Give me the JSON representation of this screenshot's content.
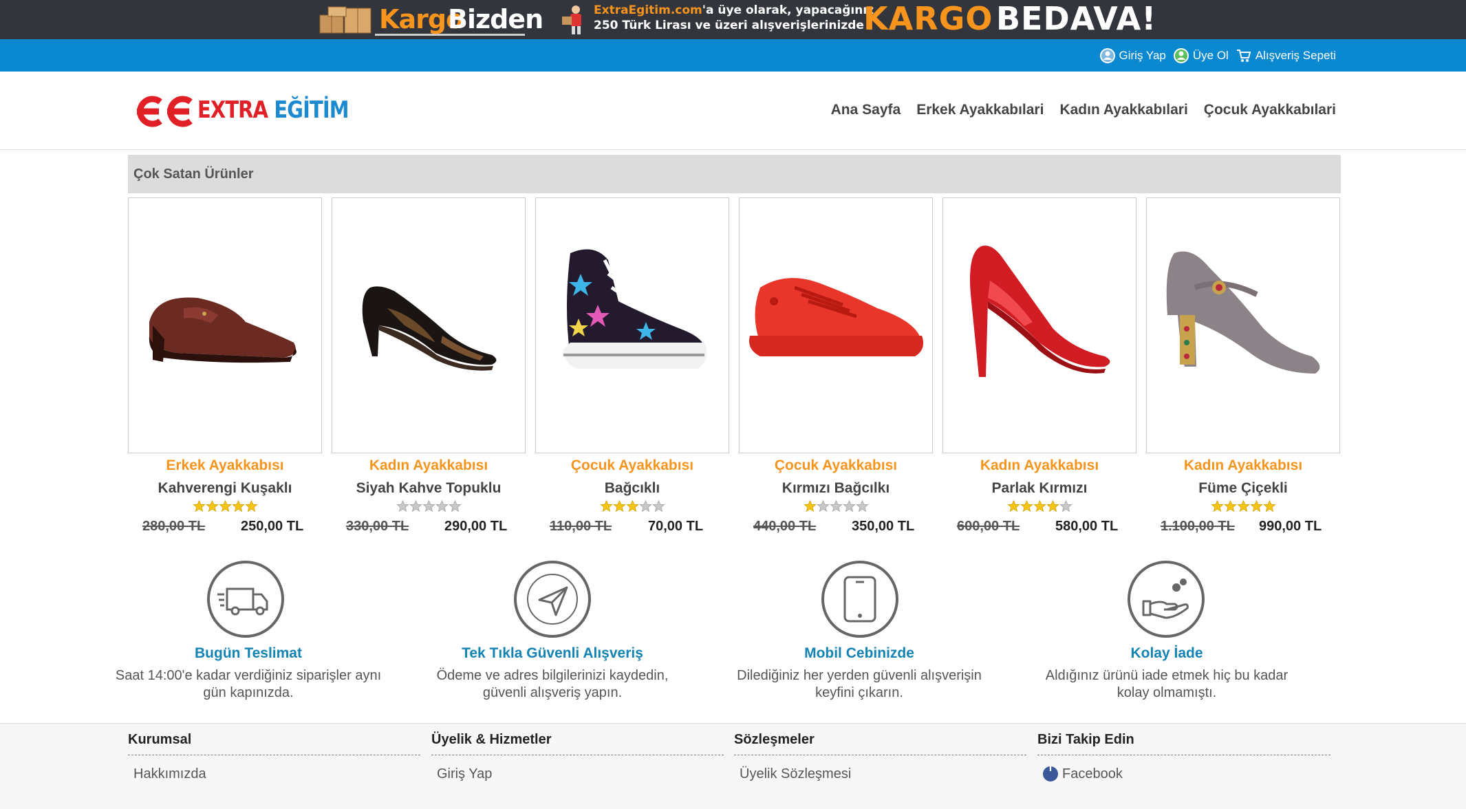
{
  "promo_banner": {
    "logo_part1": "Kargo",
    "logo_part2": "Bizden",
    "line1_brand": "ExtraEgitim.com",
    "line1_rest": "'a üye olarak, yapacağınız",
    "line2": "250 Türk Lirası ve üzeri alışverişlerinizde",
    "big1": "KARGO",
    "big2": "BEDAVA!"
  },
  "account_bar": {
    "login": "Giriş Yap",
    "register": "Üye Ol",
    "cart": "Alışveriş Sepeti"
  },
  "header": {
    "logo_word1": "EXTRA",
    "logo_word2": "EĞİTİM",
    "nav": [
      "Ana Sayfa",
      "Erkek Ayakkabılari",
      "Kadın Ayakkabılari",
      "Çocuk Ayakkabılari"
    ]
  },
  "best_sellers": {
    "title": "Çok Satan Ürünler",
    "products": [
      {
        "category": "Erkek Ayakkabısı",
        "name": "Kahverengi Kuşaklı",
        "rating": 5,
        "old_price": "280,00 TL",
        "price": "250,00 TL",
        "image": "brown-loafer-shoe"
      },
      {
        "category": "Kadın Ayakkabısı",
        "name": "Siyah Kahve Topuklu",
        "rating": 0,
        "old_price": "330,00 TL",
        "price": "290,00 TL",
        "image": "black-brown-heel-shoe"
      },
      {
        "category": "Çocuk Ayakkabısı",
        "name": "Bağcıklı",
        "rating": 3,
        "old_price": "110,00 TL",
        "price": "70,00 TL",
        "image": "starry-high-top-sneaker"
      },
      {
        "category": "Çocuk Ayakkabısı",
        "name": "Kırmızı Bağcılkı",
        "rating": 1,
        "old_price": "440,00 TL",
        "price": "350,00 TL",
        "image": "red-sneaker"
      },
      {
        "category": "Kadın Ayakkabısı",
        "name": "Parlak Kırmızı",
        "rating": 4,
        "old_price": "600,00 TL",
        "price": "580,00 TL",
        "image": "red-patent-pump"
      },
      {
        "category": "Kadın Ayakkabısı",
        "name": "Füme Çiçekli",
        "rating": 5,
        "old_price": "1.100,00 TL",
        "price": "990,00 TL",
        "image": "grey-suede-heel"
      }
    ]
  },
  "features": [
    {
      "icon": "delivery-truck-icon",
      "title": "Bugün Teslimat",
      "desc1": "Saat 14:00'e kadar verdiğiniz siparişler aynı",
      "desc2": "gün kapınızda."
    },
    {
      "icon": "paper-plane-icon",
      "title": "Tek Tıkla Güvenli Alışveriş",
      "desc1": "Ödeme ve adres bilgilerinizi kaydedin,",
      "desc2": "güvenli alışveriş yapın."
    },
    {
      "icon": "mobile-phone-icon",
      "title": "Mobil Cebinizde",
      "desc1": "Dilediğiniz her yerden güvenli alışverişin",
      "desc2": "keyfini çıkarın."
    },
    {
      "icon": "hand-return-icon",
      "title": "Kolay İade",
      "desc1": "Aldığınız ürünü iade etmek hiç bu kadar",
      "desc2": "kolay olmamıştı."
    }
  ],
  "footer": {
    "columns": [
      {
        "title": "Kurumsal",
        "items": [
          "Hakkımızda"
        ]
      },
      {
        "title": "Üyelik & Hizmetler",
        "items": [
          "Giriş Yap"
        ]
      },
      {
        "title": "Sözleşmeler",
        "items": [
          "Üyelik Sözleşmesi"
        ]
      },
      {
        "title": "Bizi Takip Edin",
        "items": [
          "Facebook"
        ]
      }
    ]
  },
  "colors": {
    "banner_bg": "#33353d",
    "account_bar_bg": "#0a89d0",
    "accent_orange": "#f7941d",
    "feature_title_blue": "#1383b3",
    "logo_red": "#e11f26",
    "logo_blue": "#1b8ad0"
  }
}
